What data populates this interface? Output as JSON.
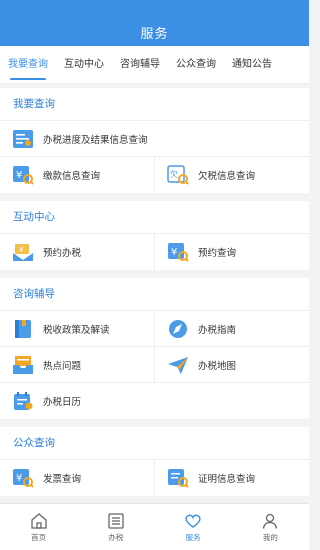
{
  "header": {
    "title": "服务"
  },
  "tabs": [
    {
      "label": "我要查询",
      "active": true
    },
    {
      "label": "互动中心"
    },
    {
      "label": "咨询辅导"
    },
    {
      "label": "公众查询"
    },
    {
      "label": "通知公告"
    }
  ],
  "sections": {
    "query": {
      "title": "我要查询",
      "items": {
        "progress": "办税进度及结果信息查询",
        "payment": "缴款信息查询",
        "arrears": "欠税信息查询"
      }
    },
    "interaction": {
      "title": "互动中心",
      "items": {
        "appointment": "预约办税",
        "appointment_query": "预约查询"
      }
    },
    "consult": {
      "title": "咨询辅导",
      "items": {
        "policy": "税收政策及解读",
        "guide": "办税指南",
        "hot": "热点问题",
        "map": "办税地图",
        "calendar": "办税日历"
      }
    },
    "public": {
      "title": "公众查询",
      "items": {
        "invoice": "发票查询",
        "certificate": "证明信息查询"
      }
    }
  },
  "bottom_nav": {
    "home": "首页",
    "tax": "办税",
    "service": "服务",
    "mine": "我的"
  },
  "colors": {
    "primary": "#3b8fe4"
  }
}
